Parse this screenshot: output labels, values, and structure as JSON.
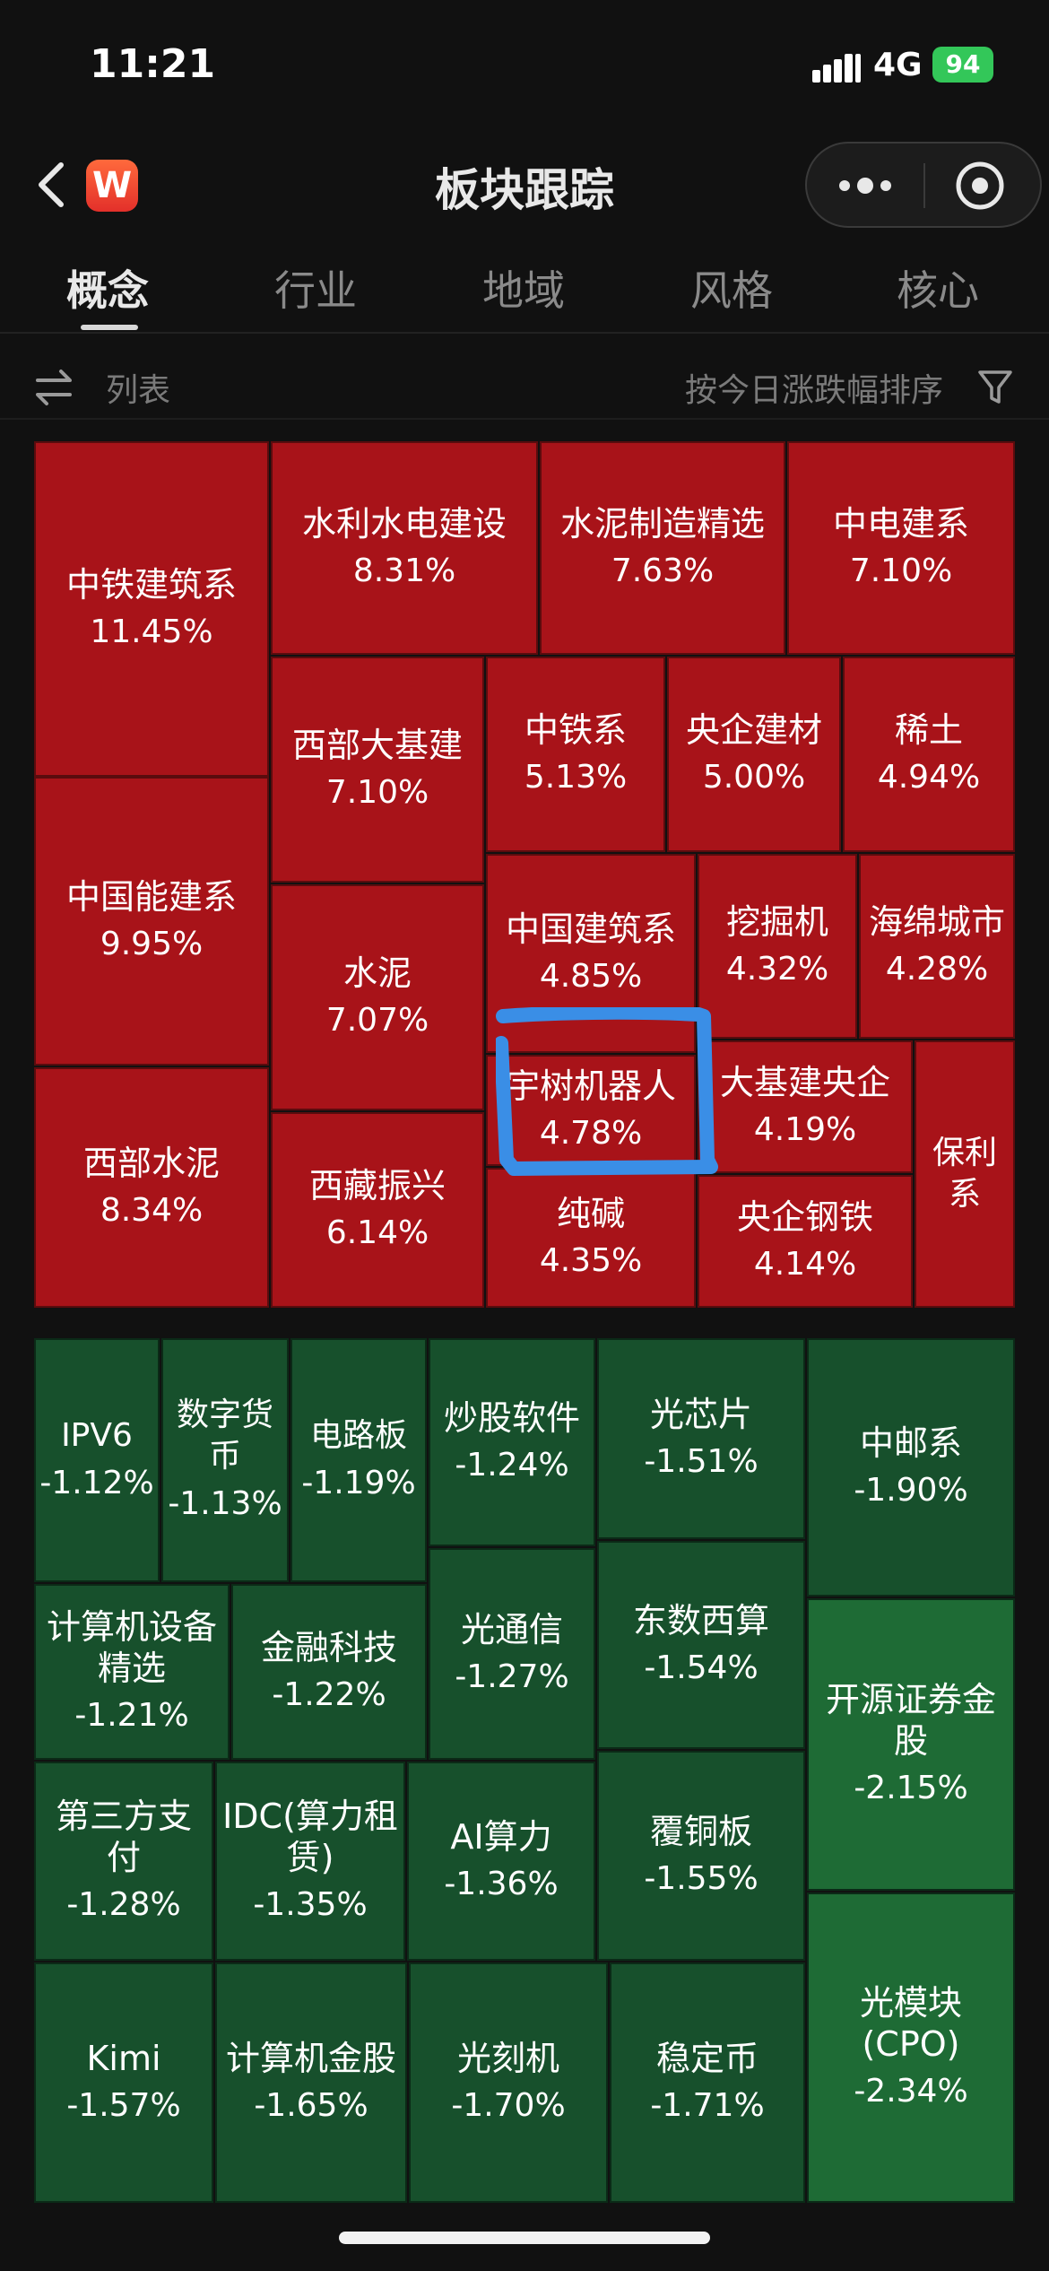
{
  "status_bar": {
    "time": "11:21",
    "network": "4G",
    "battery": "94"
  },
  "header": {
    "title": "板块跟踪"
  },
  "tabs": [
    {
      "label": "概念",
      "active": true
    },
    {
      "label": "行业",
      "active": false
    },
    {
      "label": "地域",
      "active": false
    },
    {
      "label": "风格",
      "active": false
    },
    {
      "label": "核心",
      "active": false
    }
  ],
  "toolbar": {
    "list_label": "列表",
    "sort_label": "按今日涨跌幅排序"
  },
  "colors": {
    "up": "#a81319",
    "down": "#17502c",
    "highlight": "#3a8ee6"
  },
  "sectors": [
    {
      "name": "中铁建筑系",
      "change": "11.45%"
    },
    {
      "name": "水利水电建设",
      "change": "8.31%"
    },
    {
      "name": "水泥制造精选",
      "change": "7.63%"
    },
    {
      "name": "中电建系",
      "change": "7.10%"
    },
    {
      "name": "西部大基建",
      "change": "7.10%"
    },
    {
      "name": "中铁系",
      "change": "5.13%"
    },
    {
      "name": "央企建材",
      "change": "5.00%"
    },
    {
      "name": "稀土",
      "change": "4.94%"
    },
    {
      "name": "中国能建系",
      "change": "9.95%"
    },
    {
      "name": "水泥",
      "change": "7.07%"
    },
    {
      "name": "中国建筑系",
      "change": "4.85%"
    },
    {
      "name": "挖掘机",
      "change": "4.32%"
    },
    {
      "name": "海绵城市",
      "change": "4.28%"
    },
    {
      "name": "宇树机器人",
      "change": "4.78%"
    },
    {
      "name": "大基建央企",
      "change": "4.19%"
    },
    {
      "name": "保利系",
      "change": ""
    },
    {
      "name": "西部水泥",
      "change": "8.34%"
    },
    {
      "name": "西藏振兴",
      "change": "6.14%"
    },
    {
      "name": "纯碱",
      "change": "4.35%"
    },
    {
      "name": "央企钢铁",
      "change": "4.14%"
    },
    {
      "name": "IPV6",
      "change": "-1.12%"
    },
    {
      "name": "数字货币",
      "change": "-1.13%"
    },
    {
      "name": "电路板",
      "change": "-1.19%"
    },
    {
      "name": "炒股软件",
      "change": "-1.24%"
    },
    {
      "name": "光芯片",
      "change": "-1.51%"
    },
    {
      "name": "中邮系",
      "change": "-1.90%"
    },
    {
      "name": "计算机设备精选",
      "change": "-1.21%"
    },
    {
      "name": "金融科技",
      "change": "-1.22%"
    },
    {
      "name": "光通信",
      "change": "-1.27%"
    },
    {
      "name": "东数西算",
      "change": "-1.54%"
    },
    {
      "name": "开源证券金股",
      "change": "-2.15%"
    },
    {
      "name": "第三方支付",
      "change": "-1.28%"
    },
    {
      "name": "IDC(算力租赁)",
      "change": "-1.35%"
    },
    {
      "name": "AI算力",
      "change": "-1.36%"
    },
    {
      "name": "覆铜板",
      "change": "-1.55%"
    },
    {
      "name": "Kimi",
      "change": "-1.57%"
    },
    {
      "name": "计算机金股",
      "change": "-1.65%"
    },
    {
      "name": "光刻机",
      "change": "-1.70%"
    },
    {
      "name": "稳定币",
      "change": "-1.71%"
    },
    {
      "name": "光模块(CPO)",
      "change": "-2.34%"
    }
  ]
}
